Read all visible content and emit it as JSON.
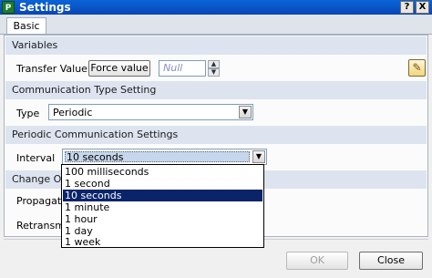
{
  "window": {
    "title": "Settings",
    "icon_letter": "P",
    "help": "?",
    "close": "X"
  },
  "tabs": [
    {
      "label": "Basic"
    }
  ],
  "variables": {
    "header": "Variables",
    "transfer_label": "Transfer Value",
    "force_button": "Force value",
    "value_placeholder": "Null"
  },
  "communication": {
    "header": "Communication Type Setting",
    "type_label": "Type",
    "type_value": "Periodic"
  },
  "periodic": {
    "header": "Periodic Communication Settings",
    "interval_label": "Interval",
    "interval_value": "10 seconds",
    "options": [
      "100 milliseconds",
      "1 second",
      "10 seconds",
      "1 minute",
      "1 hour",
      "1 day",
      "1 week"
    ]
  },
  "change_of_value": {
    "header_partial": "Change Of V",
    "propagation_partial": "Propagatio",
    "retransmit_partial": "Retransmit"
  },
  "footer": {
    "ok": "OK",
    "close": "Close"
  },
  "icons": [
    "app-icon",
    "help-icon",
    "close-icon",
    "spin-up-icon",
    "spin-down-icon",
    "edit-icon",
    "dropdown-arrow-icon"
  ]
}
